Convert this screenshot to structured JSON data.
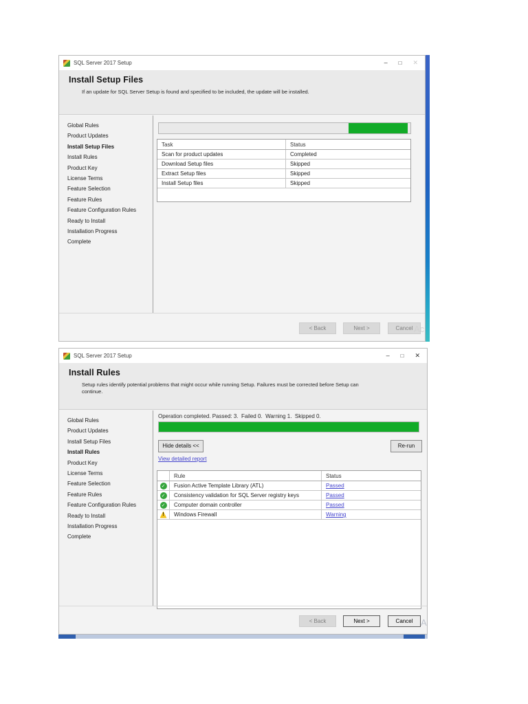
{
  "chrome": {
    "minimize": "–",
    "maximize": "□",
    "close": "✕"
  },
  "watermarks": {
    "top_fragment": "Ac",
    "bottom_fragment": "A"
  },
  "colors": {
    "progress_green": "#12ab28",
    "link_blue": "#4343cd",
    "desktop_strip_top": "#3a63c6",
    "desktop_strip_bottom": "#37bdc3"
  },
  "windows": {
    "top": {
      "title": "SQL Server 2017 Setup",
      "heading": "Install Setup Files",
      "subtitle": "If an update for SQL Server Setup is found and specified to be included, the update will be installed.",
      "sidebar": [
        "Global Rules",
        "Product Updates",
        "Install Setup Files",
        "Install Rules",
        "Product Key",
        "License Terms",
        "Feature Selection",
        "Feature Rules",
        "Feature Configuration Rules",
        "Ready to Install",
        "Installation Progress",
        "Complete"
      ],
      "progress": {
        "segment_style": "left:75.3%;width:23.6%"
      },
      "table": {
        "col_task": "Task",
        "col_status": "Status",
        "rows": [
          {
            "task": "Scan for product updates",
            "status": "Completed"
          },
          {
            "task": "Download Setup files",
            "status": "Skipped"
          },
          {
            "task": "Extract Setup files",
            "status": "Skipped"
          },
          {
            "task": "Install Setup files",
            "status": "Skipped"
          }
        ]
      },
      "buttons": {
        "back": {
          "label": "< Back",
          "state": "disabled"
        },
        "next": {
          "label": "Next >",
          "state": "disabled"
        },
        "cancel": {
          "label": "Cancel",
          "state": "disabled"
        }
      }
    },
    "bottom": {
      "title": "SQL Server 2017 Setup",
      "heading": "Install Rules",
      "subtitle": "Setup rules identify potential problems that might occur while running Setup. Failures must be corrected before Setup can continue.",
      "sidebar": [
        "Global Rules",
        "Product Updates",
        "Install Setup Files",
        "Install Rules",
        "Product Key",
        "License Terms",
        "Feature Selection",
        "Feature Rules",
        "Feature Configuration Rules",
        "Ready to Install",
        "Installation Progress",
        "Complete"
      ],
      "status_line": "Operation completed. Passed: 3.  Failed 0.  Warning 1.  Skipped 0.",
      "progress": {
        "segment_style": "left:0%;width:100%"
      },
      "hide_details_label": "Hide details <<",
      "rerun_label": "Re-run",
      "report_link": "View detailed report",
      "table": {
        "col_rule": "Rule",
        "col_status": "Status",
        "rows": [
          {
            "icon": "pass",
            "rule": "Fusion Active Template Library (ATL)",
            "status": "Passed"
          },
          {
            "icon": "pass",
            "rule": "Consistency validation for SQL Server registry keys",
            "status": "Passed"
          },
          {
            "icon": "pass",
            "rule": "Computer domain controller",
            "status": "Passed"
          },
          {
            "icon": "warning",
            "rule": "Windows Firewall",
            "status": "Warning"
          }
        ]
      },
      "buttons": {
        "back": {
          "label": "< Back",
          "state": "disabled"
        },
        "next": {
          "label": "Next >",
          "state": "enabled"
        },
        "cancel": {
          "label": "Cancel",
          "state": "enabled"
        }
      }
    }
  }
}
